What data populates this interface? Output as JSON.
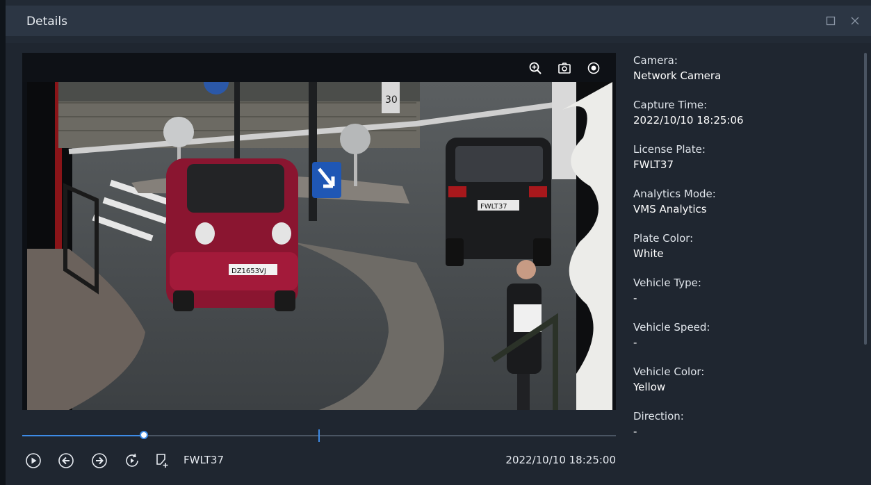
{
  "window": {
    "title": "Details",
    "maximize_icon": "maximize-icon",
    "close_icon": "close-icon"
  },
  "video_toolbar": {
    "zoom_icon": "zoom-in-icon",
    "snapshot_icon": "camera-icon",
    "record_icon": "record-icon"
  },
  "video": {
    "scene_plate_car_left": "DZ1653VJ",
    "scene_plate_car_right": "FWLT37",
    "sign_speed": "30"
  },
  "playback": {
    "progress": 0.205,
    "marker": 0.5,
    "plate": "FWLT37",
    "timestamp": "2022/10/10 18:25:00",
    "icons": [
      "play-icon",
      "previous-icon",
      "next-icon",
      "loop-play-icon",
      "add-tag-icon"
    ]
  },
  "details": [
    {
      "label": "Camera:",
      "value": "Network Camera"
    },
    {
      "label": "Capture Time:",
      "value": "2022/10/10 18:25:06"
    },
    {
      "label": "License Plate:",
      "value": "FWLT37"
    },
    {
      "label": "Analytics Mode:",
      "value": "VMS Analytics"
    },
    {
      "label": "Plate Color:",
      "value": "White"
    },
    {
      "label": "Vehicle Type:",
      "value": "-"
    },
    {
      "label": "Vehicle Speed:",
      "value": "-"
    },
    {
      "label": "Vehicle Color:",
      "value": "Yellow"
    },
    {
      "label": "Direction:",
      "value": "-"
    }
  ],
  "colors": {
    "accent": "#3d8be6",
    "background": "#1f2630",
    "titlebar": "#2c3644"
  }
}
